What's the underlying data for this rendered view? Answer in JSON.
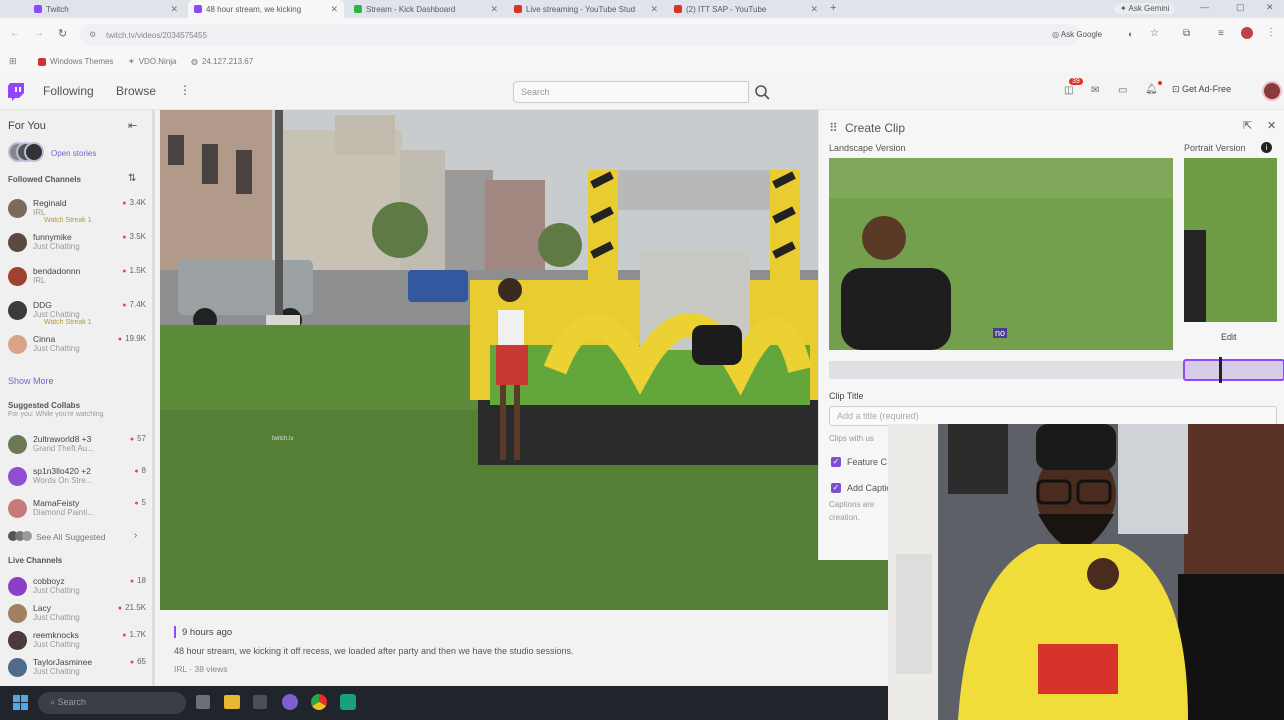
{
  "browser": {
    "tabs": [
      {
        "title": "Twitch",
        "fav_color": "#9146ff",
        "active": false
      },
      {
        "title": "48 hour stream, we kicking",
        "fav_color": "#9146ff",
        "active": true
      },
      {
        "title": "Stream - Kick Dashboard",
        "fav_color": "#2fb34a",
        "active": false
      },
      {
        "title": "Live streaming - YouTube Stud",
        "fav_color": "#e0312c",
        "active": false
      },
      {
        "title": "(2) ITT SAP - YouTube",
        "fav_color": "#e0312c",
        "active": false
      }
    ],
    "new_tab": "+",
    "ask_gemini": "Ask Gemini",
    "url": "twitch.tv/videos/2034575455",
    "ask_google": "Ask Google",
    "bookmarks": [
      "Windows Themes",
      "VDO.Ninja",
      "24.127.213.67"
    ]
  },
  "twitch_nav": {
    "following": "Following",
    "browse": "Browse",
    "more": "⋮",
    "search_placeholder": "Search",
    "notification_count": "39",
    "get_ad_free": "Get Ad-Free"
  },
  "sidebar": {
    "for_you": "For You",
    "open_stories": "Open stories",
    "followed_header": "Followed Channels",
    "followed": [
      {
        "name": "Reginald",
        "game": "IRL",
        "sub": "Watch Streak 1",
        "viewers": "3.4K",
        "color": "#7a6a5c"
      },
      {
        "name": "funnymike",
        "game": "Just Chatting",
        "sub": "",
        "viewers": "3.5K",
        "color": "#5b4a42"
      },
      {
        "name": "bendadonnn",
        "game": "IRL",
        "sub": "",
        "viewers": "1.5K",
        "color": "#a04030"
      },
      {
        "name": "DDG",
        "game": "Just Chatting",
        "sub": "Watch Streak 1",
        "viewers": "7.4K",
        "color": "#3b3b3b"
      },
      {
        "name": "Cinna",
        "game": "Just Chatting",
        "sub": "",
        "viewers": "19.9K",
        "color": "#d9a38a"
      }
    ],
    "show_more": "Show More",
    "suggested_header": "Suggested Collabs",
    "suggested_sub": "For you: While you're watching",
    "suggested": [
      {
        "name": "2ultraworld8 +3",
        "game": "Grand Theft Au...",
        "viewers": "57",
        "color": "#6b7a55"
      },
      {
        "name": "sp1n3llo420 +2",
        "game": "Words On Stre...",
        "viewers": "8",
        "color": "#8e4fd0"
      },
      {
        "name": "MamaFeisty",
        "game": "Diamond Painti...",
        "viewers": "5",
        "color": "#c67a7a"
      }
    ],
    "see_all": "See All Suggested",
    "live_header": "Live Channels",
    "live": [
      {
        "name": "cobboyz",
        "game": "Just Chatting",
        "viewers": "18",
        "color": "#8a3fc4"
      },
      {
        "name": "Lacy",
        "game": "Just Chatting",
        "viewers": "21.5K",
        "color": "#a08060"
      },
      {
        "name": "reemknocks",
        "game": "Just Chatting",
        "viewers": "1.7K",
        "color": "#4a3a3a"
      },
      {
        "name": "TaylorJasminee",
        "game": "Just Chatting",
        "viewers": "65",
        "color": "#4f6b8a"
      }
    ]
  },
  "video_info": {
    "time_ago": "9 hours ago",
    "title": "48 hour stream, we kicking it off recess, we loaded after party and then we have the studio sessions.",
    "meta": "IRL · 38 views"
  },
  "clip_panel": {
    "title": "Create Clip",
    "landscape": "Landscape Version",
    "portrait": "Portrait Version",
    "edit": "Edit",
    "clip_title_label": "Clip Title",
    "title_placeholder": "Add a title (required)",
    "clips_note": "Clips with us",
    "feature_label": "Feature C",
    "captions_label": "Add Captio",
    "captions_note": "Captions are",
    "creation": "creation.",
    "caption_badge": "no"
  },
  "taskbar": {
    "search_placeholder": "Search"
  },
  "colors": {
    "twitch_purple": "#9146ff",
    "live_red": "#e05050"
  }
}
